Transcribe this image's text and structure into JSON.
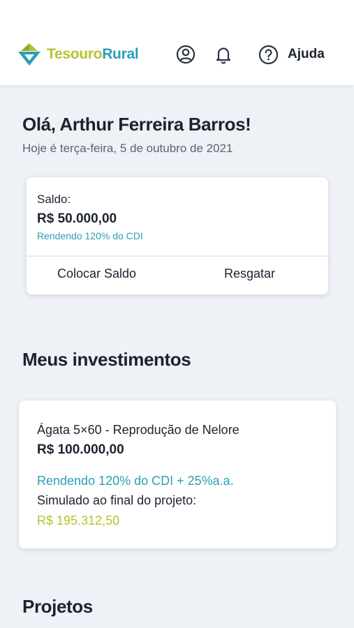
{
  "header": {
    "brand_part1": "Tesouro",
    "brand_part2": "Rural",
    "help_label": "Ajuda"
  },
  "icons": [
    "logo-icon",
    "user-icon",
    "bell-icon",
    "help-icon"
  ],
  "colors": {
    "accent_teal": "#2a9fb5",
    "accent_green": "#b7c22b",
    "text_dark": "#1c2230",
    "background": "#eef1f6"
  },
  "greeting": {
    "title": "Olá, Arthur Ferreira Barros!",
    "date": "Hoje é terça-feira, 5 de outubro de 2021"
  },
  "balance": {
    "label": "Saldo:",
    "value": "R$ 50.000,00",
    "yield": "Rendendo 120% do CDI",
    "deposit_label": "Colocar Saldo",
    "withdraw_label": "Resgatar"
  },
  "investments": {
    "section_title": "Meus investimentos",
    "items": [
      {
        "name": "Ágata 5×60 - Reprodução de Nelore",
        "value": "R$ 100.000,00",
        "yield": "Rendendo 120% do CDI + 25%a.a.",
        "simulated_label": "Simulado ao final do projeto:",
        "simulated_value": "R$ 195.312,50"
      }
    ]
  },
  "projects": {
    "section_title": "Projetos"
  }
}
